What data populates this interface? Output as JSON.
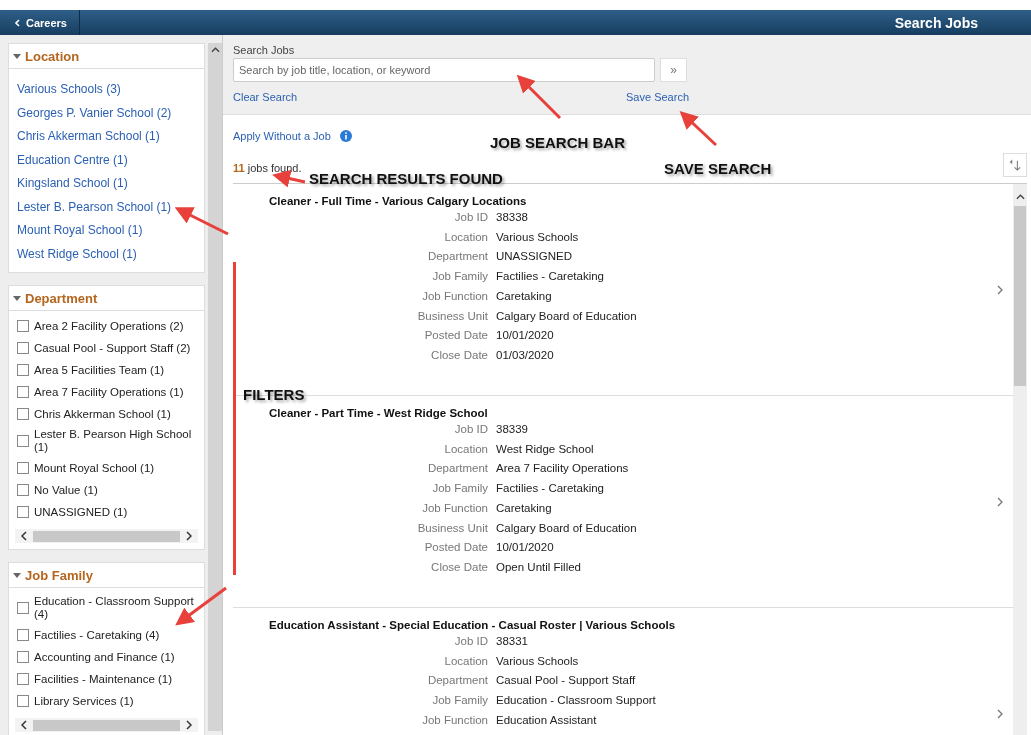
{
  "header": {
    "back_label": "Careers",
    "title": "Search Jobs"
  },
  "filters": [
    {
      "title": "Location",
      "kind": "links",
      "expanded": true,
      "items": [
        {
          "label": "Various Schools (3)"
        },
        {
          "label": "Georges P. Vanier School (2)"
        },
        {
          "label": "Chris Akkerman School (1)"
        },
        {
          "label": "Education Centre (1)"
        },
        {
          "label": "Kingsland School (1)"
        },
        {
          "label": "Lester B. Pearson School (1)"
        },
        {
          "label": "Mount Royal School (1)"
        },
        {
          "label": "West Ridge School (1)"
        }
      ]
    },
    {
      "title": "Department",
      "kind": "checkboxes",
      "expanded": true,
      "items": [
        {
          "label": "Area 2 Facility Operations (2)",
          "checked": false
        },
        {
          "label": "Casual Pool - Support Staff (2)",
          "checked": false
        },
        {
          "label": "Area 5 Facilities Team (1)",
          "checked": false
        },
        {
          "label": "Area 7 Facility Operations (1)",
          "checked": false
        },
        {
          "label": "Chris Akkerman School (1)",
          "checked": false
        },
        {
          "label": "Lester B. Pearson High School (1)",
          "checked": false
        },
        {
          "label": "Mount Royal School (1)",
          "checked": false
        },
        {
          "label": "No Value (1)",
          "checked": false
        },
        {
          "label": "UNASSIGNED (1)",
          "checked": false
        }
      ]
    },
    {
      "title": "Job Family",
      "kind": "checkboxes",
      "expanded": true,
      "items": [
        {
          "label": "Education - Classroom Support (4)",
          "checked": false
        },
        {
          "label": "Factilies - Caretaking (4)",
          "checked": false
        },
        {
          "label": "Accounting and Finance (1)",
          "checked": false
        },
        {
          "label": "Facilities - Maintenance (1)",
          "checked": false
        },
        {
          "label": "Library Services (1)",
          "checked": false
        }
      ]
    }
  ],
  "search": {
    "label": "Search Jobs",
    "placeholder": "Search by job title, location, or keyword",
    "go_button": "»",
    "clear_link": "Clear Search",
    "save_link": "Save Search"
  },
  "apply_without_job": "Apply Without a Job",
  "results": {
    "count": "11",
    "suffix": " jobs found."
  },
  "jobs": [
    {
      "title": "Cleaner - Full Time - Various Calgary Locations",
      "fields": [
        {
          "label": "Job ID",
          "value": "38338"
        },
        {
          "label": "Location",
          "value": "Various Schools"
        },
        {
          "label": "Department",
          "value": "UNASSIGNED"
        },
        {
          "label": "Job Family",
          "value": "Factilies - Caretaking"
        },
        {
          "label": "Job Function",
          "value": "Caretaking"
        },
        {
          "label": "Business Unit",
          "value": "Calgary Board of Education"
        },
        {
          "label": "Posted Date",
          "value": "10/01/2020"
        },
        {
          "label": "Close Date",
          "value": "01/03/2020"
        }
      ]
    },
    {
      "title": "Cleaner - Part Time - West Ridge School",
      "fields": [
        {
          "label": "Job ID",
          "value": "38339"
        },
        {
          "label": "Location",
          "value": "West Ridge School"
        },
        {
          "label": "Department",
          "value": "Area 7 Facility Operations"
        },
        {
          "label": "Job Family",
          "value": "Factilies - Caretaking"
        },
        {
          "label": "Job Function",
          "value": "Caretaking"
        },
        {
          "label": "Business Unit",
          "value": "Calgary Board of Education"
        },
        {
          "label": "Posted Date",
          "value": "10/01/2020"
        },
        {
          "label": "Close Date",
          "value": "Open Until Filled"
        }
      ]
    },
    {
      "title": "Education Assistant - Special Education - Casual Roster | Various Schools",
      "fields": [
        {
          "label": "Job ID",
          "value": "38331"
        },
        {
          "label": "Location",
          "value": "Various Schools"
        },
        {
          "label": "Department",
          "value": "Casual Pool - Support Staff"
        },
        {
          "label": "Job Family",
          "value": "Education - Classroom Support"
        },
        {
          "label": "Job Function",
          "value": "Education Assistant"
        }
      ]
    }
  ],
  "annotations": [
    {
      "text": "JOB SEARCH BAR"
    },
    {
      "text": "SAVE SEARCH"
    },
    {
      "text": "SEARCH RESULTS FOUND"
    },
    {
      "text": "FILTERS"
    }
  ]
}
